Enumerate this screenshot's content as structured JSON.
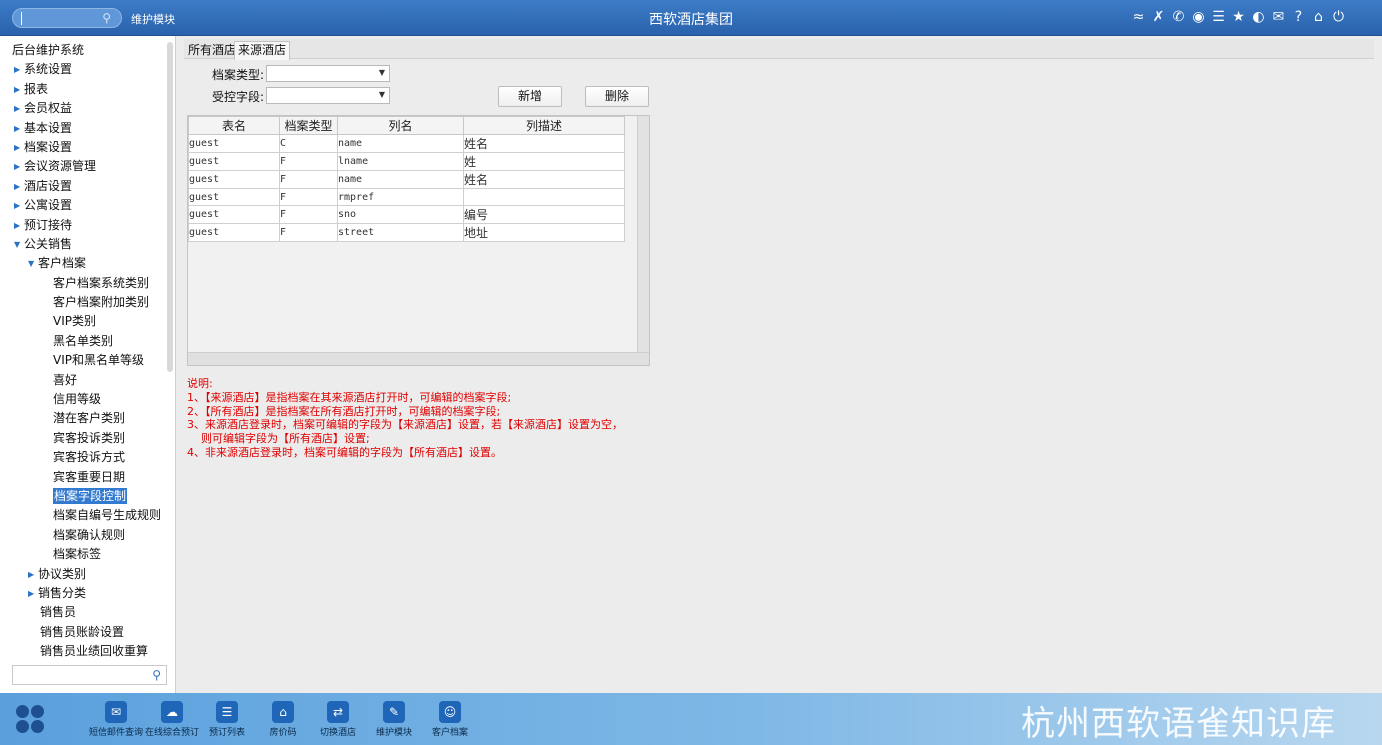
{
  "topbar": {
    "module_label": "维护模块",
    "title": "西软酒店集团",
    "icons": [
      "wifi-icon",
      "tools-icon",
      "phone-icon",
      "palette-icon",
      "menu-icon",
      "star-icon",
      "contrast-icon",
      "mail-icon",
      "help-icon",
      "home-icon",
      "power-icon"
    ]
  },
  "sidebar": {
    "root": "后台维护系统",
    "items": [
      {
        "label": "系统设置",
        "level": 1,
        "arrow": "▶"
      },
      {
        "label": "报表",
        "level": 1,
        "arrow": "▶"
      },
      {
        "label": "会员权益",
        "level": 1,
        "arrow": "▶"
      },
      {
        "label": "基本设置",
        "level": 1,
        "arrow": "▶"
      },
      {
        "label": "档案设置",
        "level": 1,
        "arrow": "▶"
      },
      {
        "label": "会议资源管理",
        "level": 1,
        "arrow": "▶"
      },
      {
        "label": "酒店设置",
        "level": 1,
        "arrow": "▶"
      },
      {
        "label": "公寓设置",
        "level": 1,
        "arrow": "▶"
      },
      {
        "label": "预订接待",
        "level": 1,
        "arrow": "▶"
      },
      {
        "label": "公关销售",
        "level": 1,
        "arrow": "▼"
      },
      {
        "label": "客户档案",
        "level": 2,
        "arrow": "▼"
      },
      {
        "label": "客户档案系统类别",
        "level": 3,
        "arrow": ""
      },
      {
        "label": "客户档案附加类别",
        "level": 3,
        "arrow": ""
      },
      {
        "label": "VIP类别",
        "level": 3,
        "arrow": ""
      },
      {
        "label": "黑名单类别",
        "level": 3,
        "arrow": ""
      },
      {
        "label": "VIP和黑名单等级",
        "level": 3,
        "arrow": ""
      },
      {
        "label": "喜好",
        "level": 3,
        "arrow": ""
      },
      {
        "label": "信用等级",
        "level": 3,
        "arrow": ""
      },
      {
        "label": "潜在客户类别",
        "level": 3,
        "arrow": ""
      },
      {
        "label": "宾客投诉类别",
        "level": 3,
        "arrow": ""
      },
      {
        "label": "宾客投诉方式",
        "level": 3,
        "arrow": ""
      },
      {
        "label": "宾客重要日期",
        "level": 3,
        "arrow": ""
      },
      {
        "label": "档案字段控制",
        "level": 3,
        "arrow": "",
        "selected": true
      },
      {
        "label": "档案自编号生成规则",
        "level": 3,
        "arrow": ""
      },
      {
        "label": "档案确认规则",
        "level": 3,
        "arrow": ""
      },
      {
        "label": "档案标签",
        "level": 3,
        "arrow": ""
      },
      {
        "label": "协议类别",
        "level": 2,
        "arrow": "▶"
      },
      {
        "label": "销售分类",
        "level": 2,
        "arrow": "▶"
      },
      {
        "label": "销售员",
        "level": 4,
        "arrow": ""
      },
      {
        "label": "销售员账龄设置",
        "level": 4,
        "arrow": ""
      },
      {
        "label": "销售员业绩回收重算",
        "level": 4,
        "arrow": ""
      }
    ]
  },
  "tabs": [
    "所有酒店",
    "来源酒店"
  ],
  "form": {
    "type_label": "档案类型:",
    "type_value": "",
    "field_label": "受控字段:",
    "field_value": "",
    "add_button": "新增",
    "delete_button": "删除"
  },
  "grid": {
    "columns": [
      "表名",
      "档案类型",
      "列名",
      "列描述"
    ],
    "rows": [
      [
        "guest",
        "C",
        "name",
        "姓名"
      ],
      [
        "guest",
        "F",
        "lname",
        "姓"
      ],
      [
        "guest",
        "F",
        "name",
        "姓名"
      ],
      [
        "guest",
        "F",
        "rmpref",
        ""
      ],
      [
        "guest",
        "F",
        "sno",
        "编号"
      ],
      [
        "guest",
        "F",
        "street",
        "地址"
      ]
    ]
  },
  "notes": [
    "说明:",
    "1、【来源酒店】是指档案在其来源酒店打开时，可编辑的档案字段;",
    "2、【所有酒店】是指档案在所有酒店打开时，可编辑的档案字段;",
    "3、来源酒店登录时，档案可编辑的字段为【来源酒店】设置，若【来源酒店】设置为空，",
    "    则可编辑字段为【所有酒店】设置;",
    "4、非来源酒店登录时，档案可编辑的字段为【所有酒店】设置。"
  ],
  "dock": {
    "items": [
      {
        "label": "短信邮件查询",
        "icon": "mail-icon"
      },
      {
        "label": "在线综合预订",
        "icon": "cloud-icon"
      },
      {
        "label": "预订列表",
        "icon": "list-icon"
      },
      {
        "label": "房价码",
        "icon": "home-icon"
      },
      {
        "label": "切换酒店",
        "icon": "switch-icon"
      },
      {
        "label": "维护模块",
        "icon": "wrench-icon"
      },
      {
        "label": "客户档案",
        "icon": "profile-icon"
      }
    ],
    "watermark": "杭州西软语雀知识库"
  },
  "colors": {
    "topbar": "#2f6db6",
    "selected": "#3279d0",
    "notes": "#e00000"
  }
}
